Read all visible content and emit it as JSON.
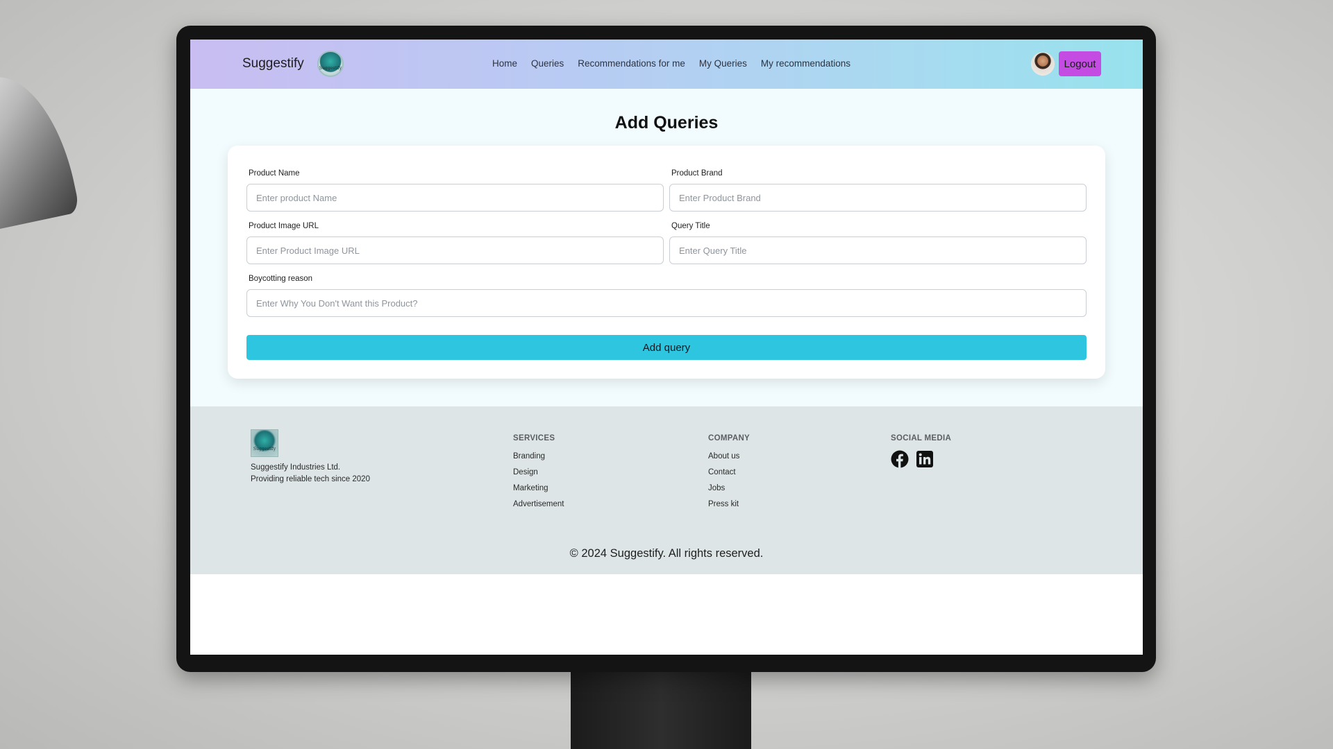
{
  "navbar": {
    "brand": "Suggestify",
    "logo_text": "Suggestify",
    "links": [
      "Home",
      "Queries",
      "Recommendations for me",
      "My Queries",
      "My recommendations"
    ],
    "logout_label": "Logout"
  },
  "page": {
    "title": "Add Queries"
  },
  "form": {
    "product_name": {
      "label": "Product Name",
      "placeholder": "Enter product Name"
    },
    "product_brand": {
      "label": "Product Brand",
      "placeholder": "Enter Product Brand"
    },
    "product_image_url": {
      "label": "Product Image URL",
      "placeholder": "Enter Product Image URL"
    },
    "query_title": {
      "label": "Query Title",
      "placeholder": "Enter Query Title"
    },
    "boycotting_reason": {
      "label": "Boycotting reason",
      "placeholder": "Enter Why You Don't Want this Product?"
    },
    "submit_label": "Add query"
  },
  "footer": {
    "logo_text": "Suggestify",
    "company_name": "Suggestify Industries Ltd.",
    "tagline": "Providing reliable tech since 2020",
    "services": {
      "heading": "SERVICES",
      "items": [
        "Branding",
        "Design",
        "Marketing",
        "Advertisement"
      ]
    },
    "company": {
      "heading": "COMPANY",
      "items": [
        "About us",
        "Contact",
        "Jobs",
        "Press kit"
      ]
    },
    "social": {
      "heading": "SOCIAL MEDIA",
      "icons": [
        "facebook-icon",
        "linkedin-icon"
      ]
    },
    "copyright": "© 2024 Suggestify. All rights reserved."
  },
  "colors": {
    "navbar_gradient_start": "#c9bdf1",
    "navbar_gradient_end": "#98e2ee",
    "logout_button": "#c44ce3",
    "submit_button": "#2dc5df",
    "main_background": "#f2fbfd",
    "footer_background": "#dde5e6"
  }
}
